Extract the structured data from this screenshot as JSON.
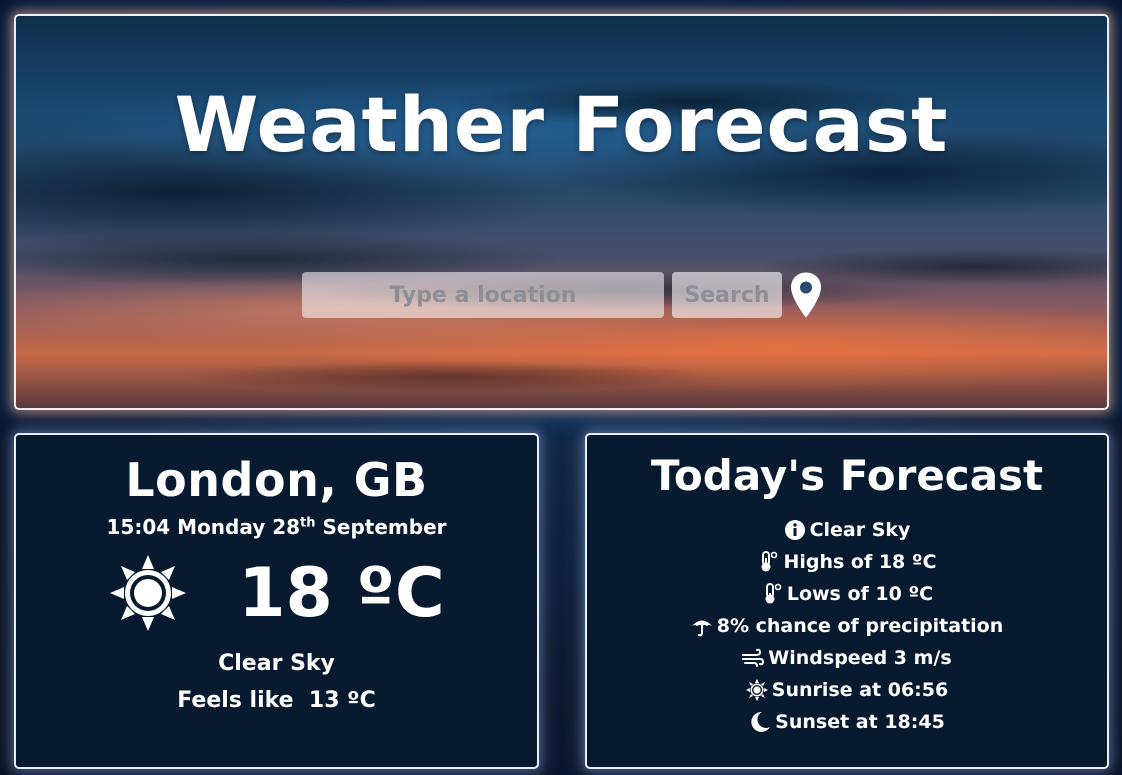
{
  "hero": {
    "title": "Weather Forecast",
    "search_placeholder": "Type a location",
    "search_label": "Search"
  },
  "current": {
    "city": "London, GB",
    "time": "15:04 Monday 28",
    "day_suffix": "th",
    "month": "September",
    "temperature": "18 ºC",
    "condition": "Clear Sky",
    "feels_like": "Feels like  13 ºC",
    "icon": "sun-icon"
  },
  "forecast": {
    "title": "Today's Forecast",
    "items": [
      {
        "icon": "info-icon",
        "text": "Clear Sky"
      },
      {
        "icon": "thermometer-icon",
        "text": "Highs of 18 ºC"
      },
      {
        "icon": "thermometer-icon",
        "text": "Lows of 10 ºC"
      },
      {
        "icon": "umbrella-icon",
        "text": "8% chance of precipitation"
      },
      {
        "icon": "wind-icon",
        "text": "Windspeed 3 m/s"
      },
      {
        "icon": "sunrise-icon",
        "text": "Sunrise at 06:56"
      },
      {
        "icon": "moon-icon",
        "text": "Sunset at 18:45"
      }
    ]
  },
  "colors": {
    "card_bg": "#071a30",
    "border": "#e9eef6",
    "text": "#ffffff"
  }
}
